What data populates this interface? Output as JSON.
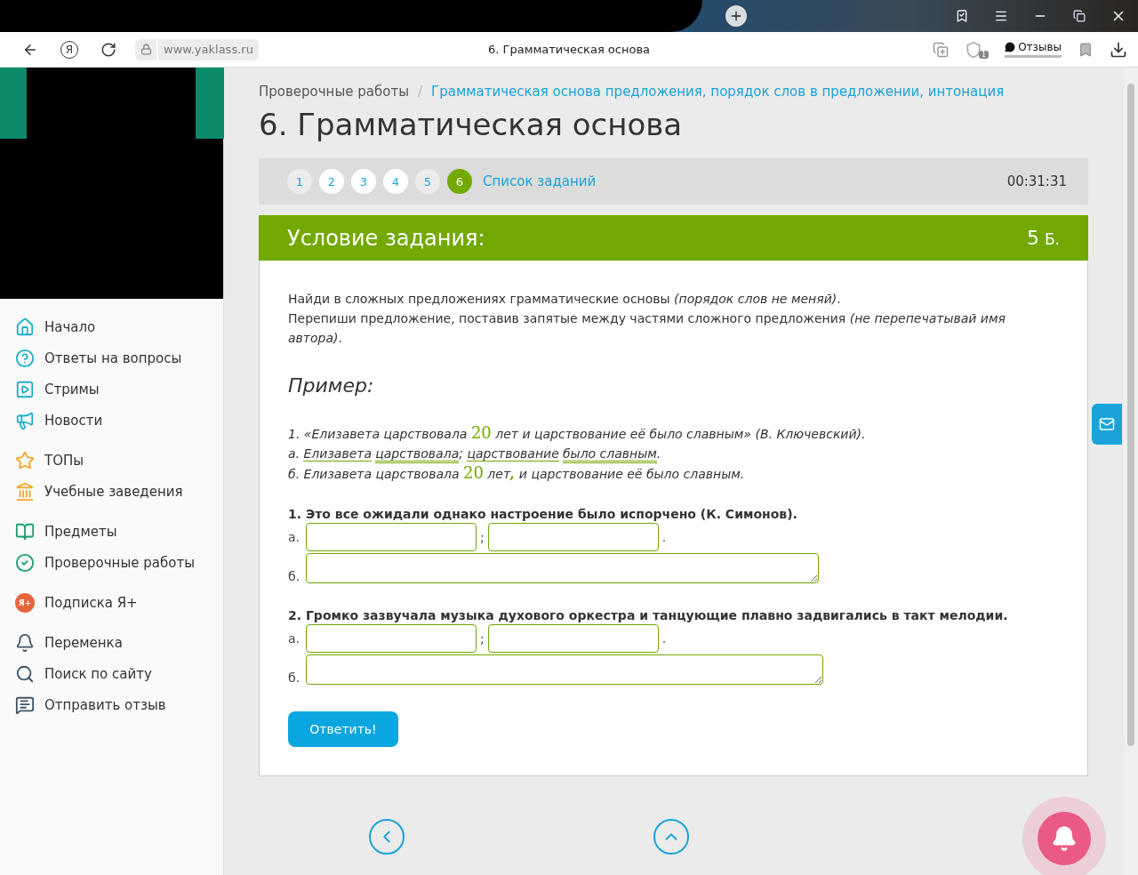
{
  "browser": {
    "logo_letter": "Я",
    "url": "www.yaklass.ru",
    "page_title": "6. Грамматическая основа",
    "shield_count": "1",
    "feedback": "Отзывы"
  },
  "sidebar": {
    "groups": [
      [
        {
          "label": "Начало"
        },
        {
          "label": "Ответы на вопросы"
        },
        {
          "label": "Стримы"
        },
        {
          "label": "Новости"
        }
      ],
      [
        {
          "label": "ТОПы"
        },
        {
          "label": "Учебные заведения"
        }
      ],
      [
        {
          "label": "Предметы"
        },
        {
          "label": "Проверочные работы"
        }
      ],
      [
        {
          "label": "Подписка Я+",
          "icon_text": "Я+"
        }
      ],
      [
        {
          "label": "Переменка"
        },
        {
          "label": "Поиск по сайту"
        },
        {
          "label": "Отправить отзыв"
        }
      ]
    ]
  },
  "breadcrumb_separator": "/",
  "breadcrumbs": [
    {
      "label": "Проверочные работы",
      "kind": "parent"
    },
    {
      "label": "Грамматическая основа предложения, порядок слов в предложении, интонация",
      "kind": "link"
    }
  ],
  "title": "6. Грамматическая основа",
  "tasks": [
    {
      "label": "1",
      "selected": false,
      "visited": true
    },
    {
      "label": "2",
      "selected": false,
      "visited": false
    },
    {
      "label": "3",
      "selected": false,
      "visited": false
    },
    {
      "label": "4",
      "selected": false,
      "visited": false
    },
    {
      "label": "5",
      "selected": false,
      "visited": true
    },
    {
      "label": "6",
      "selected": true,
      "visited": false
    }
  ],
  "task_list_link": "Список заданий",
  "timer": "00:31:31",
  "condition": {
    "heading": "Условие задания:",
    "points": "5",
    "points_unit": "Б."
  },
  "instructions": [
    "Найди в сложных предложениях грамматические основы *(порядок слов не меняй)*.",
    "Перепиши предложение, поставив запятые между частями сложного предложения *(не перепечатывай имя автора)*."
  ],
  "example": {
    "heading": "Пример:",
    "lines": [
      [
        {
          "text": "1. «Елизавета царствовала ",
          "kind": "text"
        },
        {
          "text": "20",
          "kind": "number"
        },
        {
          "text": " лет и царствование её было славным» (В. Ключевский).",
          "kind": "text"
        }
      ],
      [
        {
          "text": "а. ",
          "kind": "text"
        },
        {
          "text": "Елизавета",
          "kind": "subject"
        },
        {
          "text": "царствовала",
          "kind": "predicate",
          "gap": true
        },
        {
          "text": "; ",
          "kind": "text"
        },
        {
          "text": "царствование",
          "kind": "subject"
        },
        {
          "text": "было славным",
          "kind": "predicate",
          "gap": true
        },
        {
          "text": ".",
          "kind": "text"
        }
      ],
      [
        {
          "text": "б. Елизавета царствовала ",
          "kind": "text"
        },
        {
          "text": "20",
          "kind": "number"
        },
        {
          "text": " лет",
          "kind": "text"
        },
        {
          "text": ",",
          "kind": "mark"
        },
        {
          "text": " и царствование её было славным.",
          "kind": "text"
        }
      ]
    ]
  },
  "exercises": [
    {
      "sentence": "1. Это все ожидали однако настроение было испорчено (К. Симонов).",
      "label_a": "а.",
      "separator": ";",
      "end": ".",
      "label_b": "б."
    },
    {
      "sentence": "2. Громко зазвучала музыка духового оркестра и танцующие плавно задвигались в такт мелодии.",
      "label_a": "а.",
      "separator": ";",
      "end": ".",
      "label_b": "б."
    }
  ],
  "submit": "Ответить!"
}
